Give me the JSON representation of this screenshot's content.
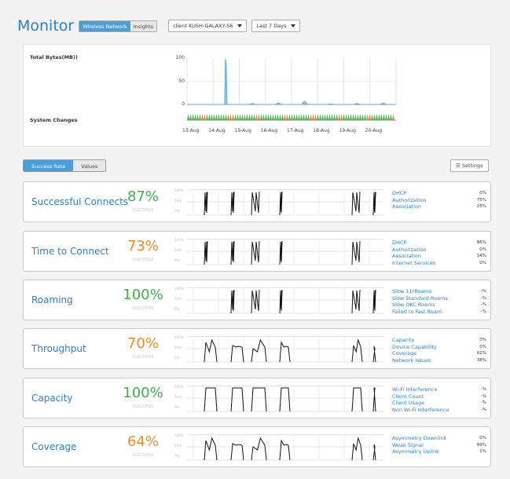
{
  "header": {
    "title": "Monitor",
    "tabs": [
      {
        "label": "Wireless Network",
        "active": true
      },
      {
        "label": "Insights",
        "active": false
      }
    ],
    "client_select": "client KUSH-GALAXY-S6",
    "range_select": "Last 7 Days"
  },
  "overview": {
    "total_bytes_label": "Total Bytes(MB))",
    "system_changes_label": "System Changes",
    "chart_data": {
      "type": "area",
      "ylabel": "",
      "yticks": [
        "100",
        "50",
        "0"
      ],
      "ylim": [
        0,
        100
      ],
      "categories": [
        "13-Aug",
        "14-Aug",
        "15-Aug",
        "16-Aug",
        "17-Aug",
        "18-Aug",
        "19-Aug",
        "20-Aug"
      ],
      "series": [
        {
          "values": [
            0,
            98,
            2,
            3,
            7,
            1,
            2,
            3
          ]
        }
      ],
      "colors": {
        "line": "#5aaad8",
        "changes_green": "#46b84a",
        "changes_orange": "#e08a2a"
      }
    }
  },
  "view_tabs": [
    {
      "label": "Success Rate",
      "active": true
    },
    {
      "label": "Values",
      "active": false
    }
  ],
  "settings_label": "☰ Settings",
  "mini_ticks": [
    "100%",
    "50%",
    "0%"
  ],
  "cards": [
    {
      "name": "Successful Connects",
      "pct": "87%",
      "sub": "success",
      "color": "green",
      "stats": [
        {
          "k": "DHCP",
          "v": "0%"
        },
        {
          "k": "Authorization",
          "v": "75%"
        },
        {
          "k": "Association",
          "v": "25%"
        }
      ]
    },
    {
      "name": "Time to Connect",
      "pct": "73%",
      "sub": "success",
      "color": "orange",
      "stats": [
        {
          "k": "DHCP",
          "v": "86%"
        },
        {
          "k": "Authorization",
          "v": "0%"
        },
        {
          "k": "Association",
          "v": "14%"
        },
        {
          "k": "Internet Services",
          "v": "0%"
        }
      ]
    },
    {
      "name": "Roaming",
      "pct": "100%",
      "sub": "success",
      "color": "green",
      "stats": [
        {
          "k": "Slow 11rRoams",
          "v": "-%"
        },
        {
          "k": "Slow Standard Roams",
          "v": "-%"
        },
        {
          "k": "Slow OKC Roams",
          "v": "-%"
        },
        {
          "k": "Failed to Fast Roam",
          "v": "-%"
        }
      ]
    },
    {
      "name": "Throughput",
      "pct": "70%",
      "sub": "success",
      "color": "orange",
      "stats": [
        {
          "k": "Capacity",
          "v": "0%"
        },
        {
          "k": "Device Capability",
          "v": "0%"
        },
        {
          "k": "Coverage",
          "v": "62%"
        },
        {
          "k": "Network Issues",
          "v": "38%"
        }
      ]
    },
    {
      "name": "Capacity",
      "pct": "100%",
      "sub": "success",
      "color": "green",
      "stats": [
        {
          "k": "Wi-Fi Interference",
          "v": "-%"
        },
        {
          "k": "Client Count",
          "v": "-%"
        },
        {
          "k": "Client Usage",
          "v": "-%"
        },
        {
          "k": "Non Wi-Fi Interference",
          "v": "-%"
        }
      ]
    },
    {
      "name": "Coverage",
      "pct": "64%",
      "sub": "success",
      "color": "orange",
      "stats": [
        {
          "k": "Asymmetry Downlink",
          "v": "0%"
        },
        {
          "k": "Weak Signal",
          "v": "99%"
        },
        {
          "k": "Asymmetry Uplink",
          "v": "1%"
        }
      ]
    }
  ]
}
